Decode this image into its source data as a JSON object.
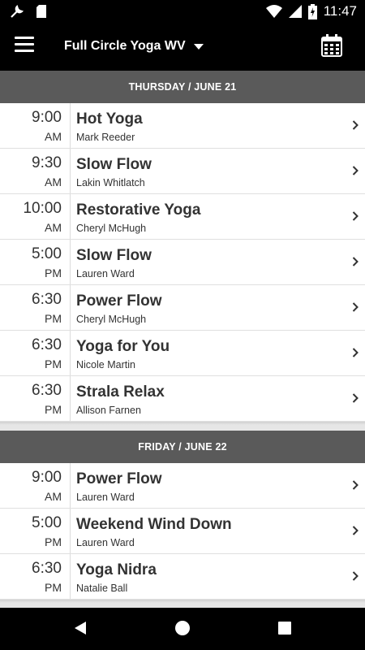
{
  "status_bar": {
    "time": "11:47"
  },
  "toolbar": {
    "studio_name": "Full Circle Yoga WV"
  },
  "days": [
    {
      "header": "THURSDAY / JUNE 21",
      "classes": [
        {
          "time": "9:00",
          "ampm": "AM",
          "name": "Hot Yoga",
          "instructor": "Mark Reeder"
        },
        {
          "time": "9:30",
          "ampm": "AM",
          "name": "Slow Flow",
          "instructor": "Lakin Whitlatch"
        },
        {
          "time": "10:00",
          "ampm": "AM",
          "name": "Restorative Yoga",
          "instructor": "Cheryl McHugh"
        },
        {
          "time": "5:00",
          "ampm": "PM",
          "name": "Slow Flow",
          "instructor": "Lauren Ward"
        },
        {
          "time": "6:30",
          "ampm": "PM",
          "name": "Power Flow",
          "instructor": "Cheryl McHugh"
        },
        {
          "time": "6:30",
          "ampm": "PM",
          "name": "Yoga for You",
          "instructor": "Nicole Martin"
        },
        {
          "time": "6:30",
          "ampm": "PM",
          "name": "Strala Relax",
          "instructor": "Allison Farnen"
        }
      ]
    },
    {
      "header": "FRIDAY / JUNE 22",
      "classes": [
        {
          "time": "9:00",
          "ampm": "AM",
          "name": "Power Flow",
          "instructor": "Lauren Ward"
        },
        {
          "time": "5:00",
          "ampm": "PM",
          "name": "Weekend Wind Down",
          "instructor": "Lauren Ward"
        },
        {
          "time": "6:30",
          "ampm": "PM",
          "name": "Yoga Nidra",
          "instructor": "Natalie Ball"
        }
      ]
    }
  ]
}
